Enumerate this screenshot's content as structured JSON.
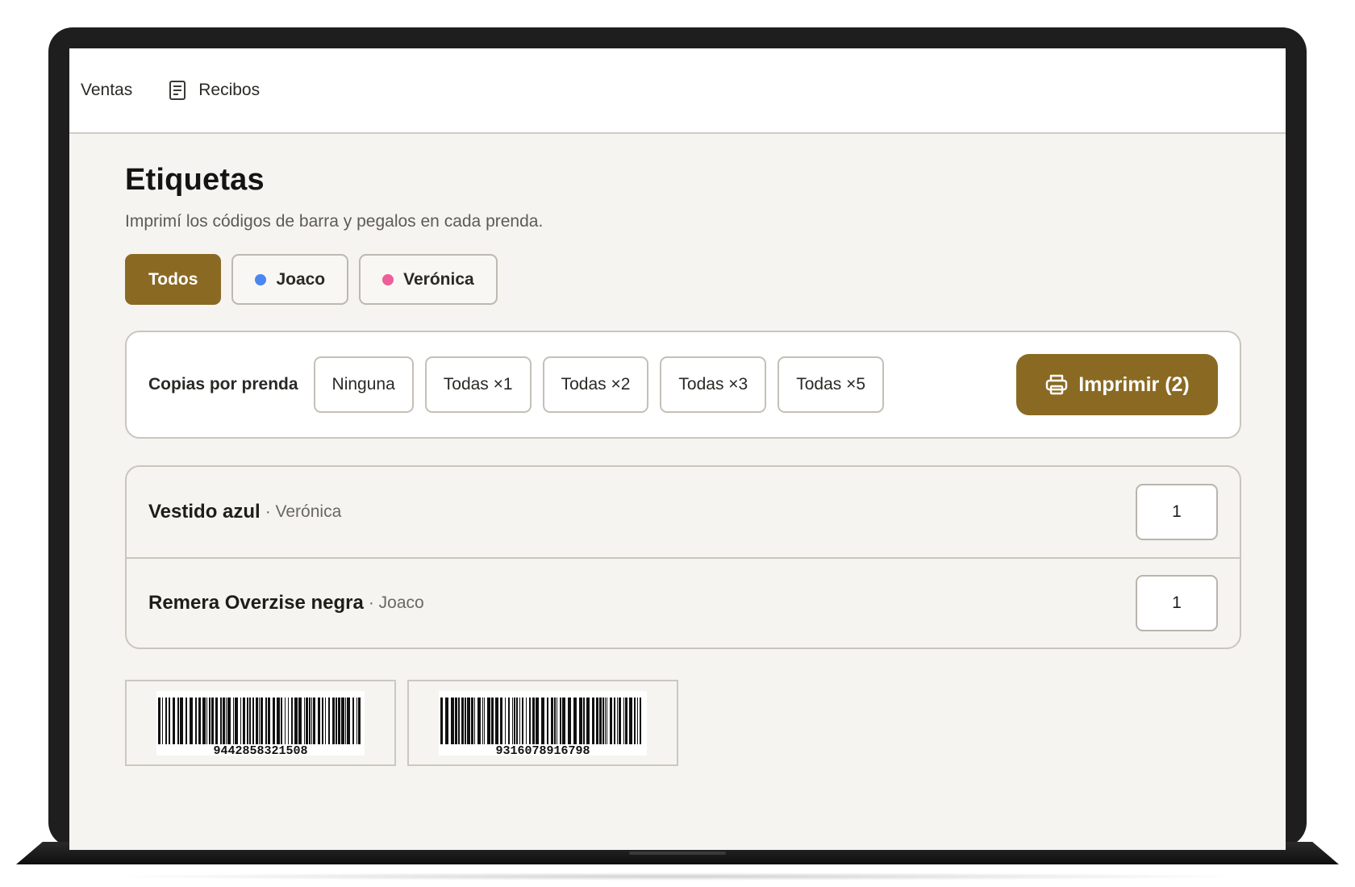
{
  "nav": {
    "ventas_label": "Ventas",
    "recibos_label": "Recibos",
    "recibos_icon": "receipt-icon"
  },
  "page": {
    "title": "Etiquetas",
    "subtitle": "Imprimí los códigos de barra y pegalos en cada prenda."
  },
  "filters": [
    {
      "label": "Todos",
      "active": true,
      "color": ""
    },
    {
      "label": "Joaco",
      "active": false,
      "color": "#4c86f0"
    },
    {
      "label": "Verónica",
      "active": false,
      "color": "#ec5f9a"
    }
  ],
  "copies": {
    "label": "Copias por prenda",
    "options": [
      "Ninguna",
      "Todas ×1",
      "Todas ×2",
      "Todas ×3",
      "Todas ×5"
    ],
    "print_label": "Imprimir (2)",
    "print_icon": "printer-icon"
  },
  "items": [
    {
      "name": "Vestido azul",
      "owner": "· Verónica",
      "qty": "1"
    },
    {
      "name": "Remera Overzise negra",
      "owner": "· Joaco",
      "qty": "1"
    }
  ],
  "labels": [
    {
      "code": "9442858321508"
    },
    {
      "code": "9316078916798"
    }
  ],
  "colors": {
    "accent": "#8a6a23",
    "background": "#f5f4f0"
  }
}
